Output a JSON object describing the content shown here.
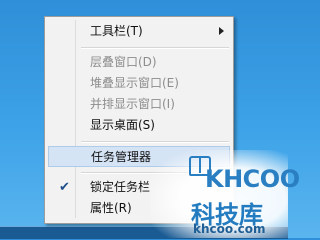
{
  "menu": {
    "items": [
      {
        "label": "工具栏(T)",
        "disabled": false,
        "submenu": true
      },
      {
        "label": "层叠窗口(D)",
        "disabled": true
      },
      {
        "label": "堆叠显示窗口(E)",
        "disabled": true
      },
      {
        "label": "并排显示窗口(I)",
        "disabled": true
      },
      {
        "label": "显示桌面(S)",
        "disabled": false
      },
      {
        "label": "任务管理器",
        "disabled": false,
        "highlighted": true
      },
      {
        "label": "锁定任务栏",
        "disabled": false,
        "checked": true
      },
      {
        "label": "属性(R)",
        "disabled": false
      }
    ],
    "icons": {
      "submenu": "chevron-right-icon",
      "checked": "checkmark-icon"
    },
    "colors": {
      "highlight_bg": "#d5e4f5",
      "disabled_text": "#8d8d8d"
    }
  },
  "watermark": {
    "brand": "KHCOO",
    "title": "科技库",
    "domain": "khcoo.com"
  }
}
